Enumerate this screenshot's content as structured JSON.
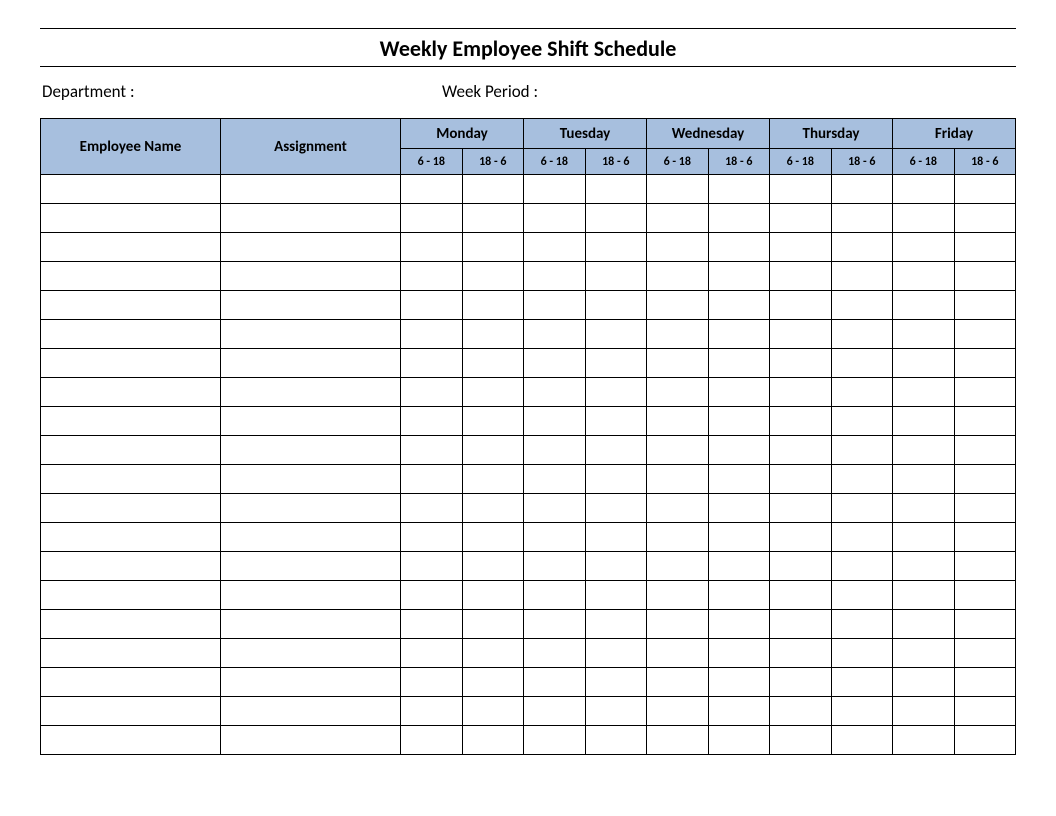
{
  "title": "Weekly Employee Shift Schedule",
  "meta": {
    "department_label": "Department :",
    "week_period_label": "Week  Period :"
  },
  "headers": {
    "employee_name": "Employee Name",
    "assignment": "Assignment",
    "days": [
      "Monday",
      "Tuesday",
      "Wednesday",
      "Thursday",
      "Friday"
    ],
    "shifts": [
      "6 - 18",
      "18 - 6"
    ]
  },
  "row_count": 20,
  "colors": {
    "header_bg": "#a7bfde"
  }
}
